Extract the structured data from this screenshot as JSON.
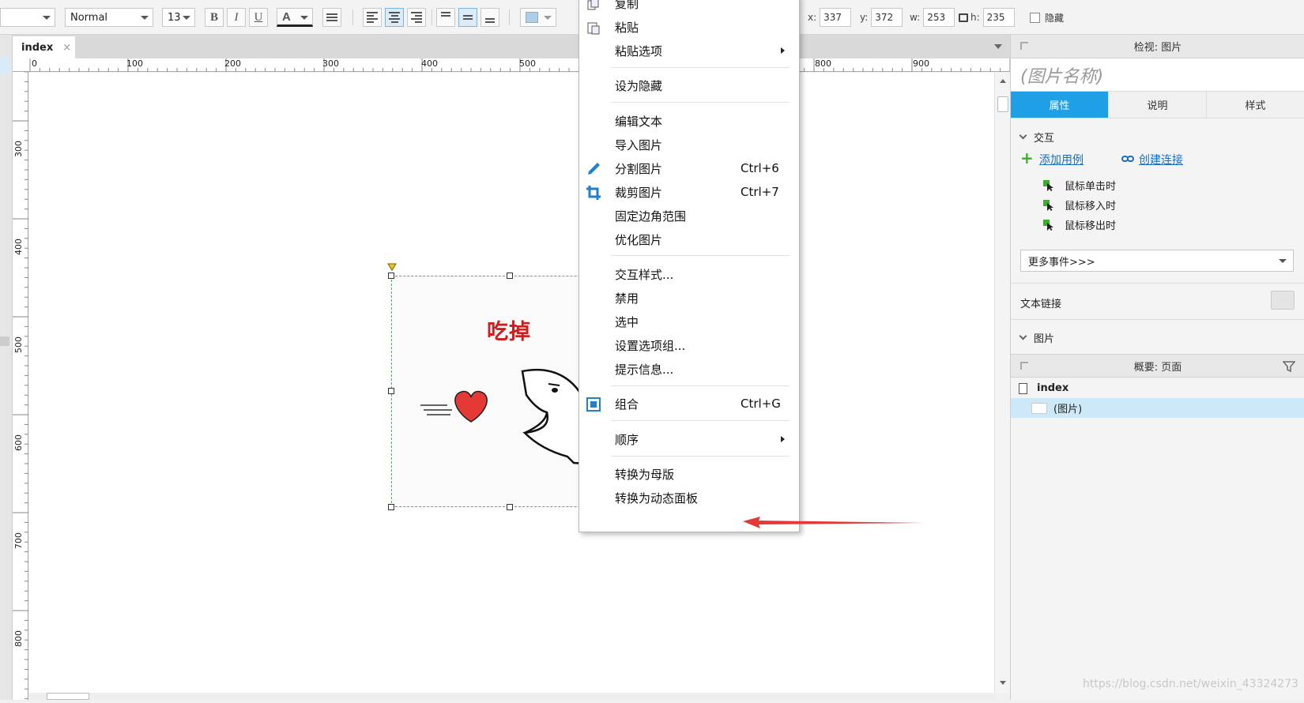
{
  "toolbar": {
    "style_select": "Normal",
    "font_size": "13",
    "bold": "B",
    "italic": "I",
    "underline": "U",
    "font_color": "A",
    "x_label": "x:",
    "x_value": "337",
    "y_label": "y:",
    "y_value": "372",
    "w_label": "w:",
    "w_value": "253",
    "h_label": "h:",
    "h_value": "235",
    "hidden_label": "隐藏"
  },
  "document_tab": {
    "label": "index",
    "close": "×"
  },
  "ruler": {
    "horizontal": [
      "0",
      "100",
      "200",
      "300",
      "400",
      "500",
      "800",
      "900"
    ],
    "vertical": [
      "300",
      "400",
      "500",
      "600",
      "700",
      "800"
    ]
  },
  "canvas": {
    "image_title": "吃掉"
  },
  "context_menu": {
    "items": [
      {
        "label": "复制"
      },
      {
        "label": "粘贴"
      },
      {
        "label": "粘贴选项"
      },
      {
        "label": "设为隐藏"
      },
      {
        "label": "编辑文本"
      },
      {
        "label": "导入图片"
      },
      {
        "label": "分割图片",
        "shortcut": "Ctrl+6"
      },
      {
        "label": "裁剪图片",
        "shortcut": "Ctrl+7"
      },
      {
        "label": "固定边角范围"
      },
      {
        "label": "优化图片"
      },
      {
        "label": "交互样式..."
      },
      {
        "label": "禁用"
      },
      {
        "label": "选中"
      },
      {
        "label": "设置选项组..."
      },
      {
        "label": "提示信息..."
      },
      {
        "label": "组合",
        "shortcut": "Ctrl+G"
      },
      {
        "label": "顺序"
      },
      {
        "label": "转换为母版"
      },
      {
        "label": "转换为动态面板"
      }
    ]
  },
  "inspector": {
    "header": "检视: 图片",
    "widget_name_placeholder": "(图片名称)",
    "tabs": [
      "属性",
      "说明",
      "样式"
    ],
    "interaction_section": "交互",
    "add_case": "添加用例",
    "create_link": "创建连接",
    "events": [
      "鼠标单击时",
      "鼠标移入时",
      "鼠标移出时"
    ],
    "more_events": "更多事件>>>",
    "text_link": "文本链接",
    "image_section": "图片"
  },
  "outline": {
    "header": "概要: 页面",
    "page": "index",
    "item": "(图片)"
  },
  "watermark": "https://blog.csdn.net/weixin_43324273",
  "colors": {
    "accent": "#1fa0e6",
    "link": "#1a6fc4",
    "arrow": "#e53935",
    "title_red": "#cc1f1f",
    "selection_green": "#2ecc40"
  }
}
